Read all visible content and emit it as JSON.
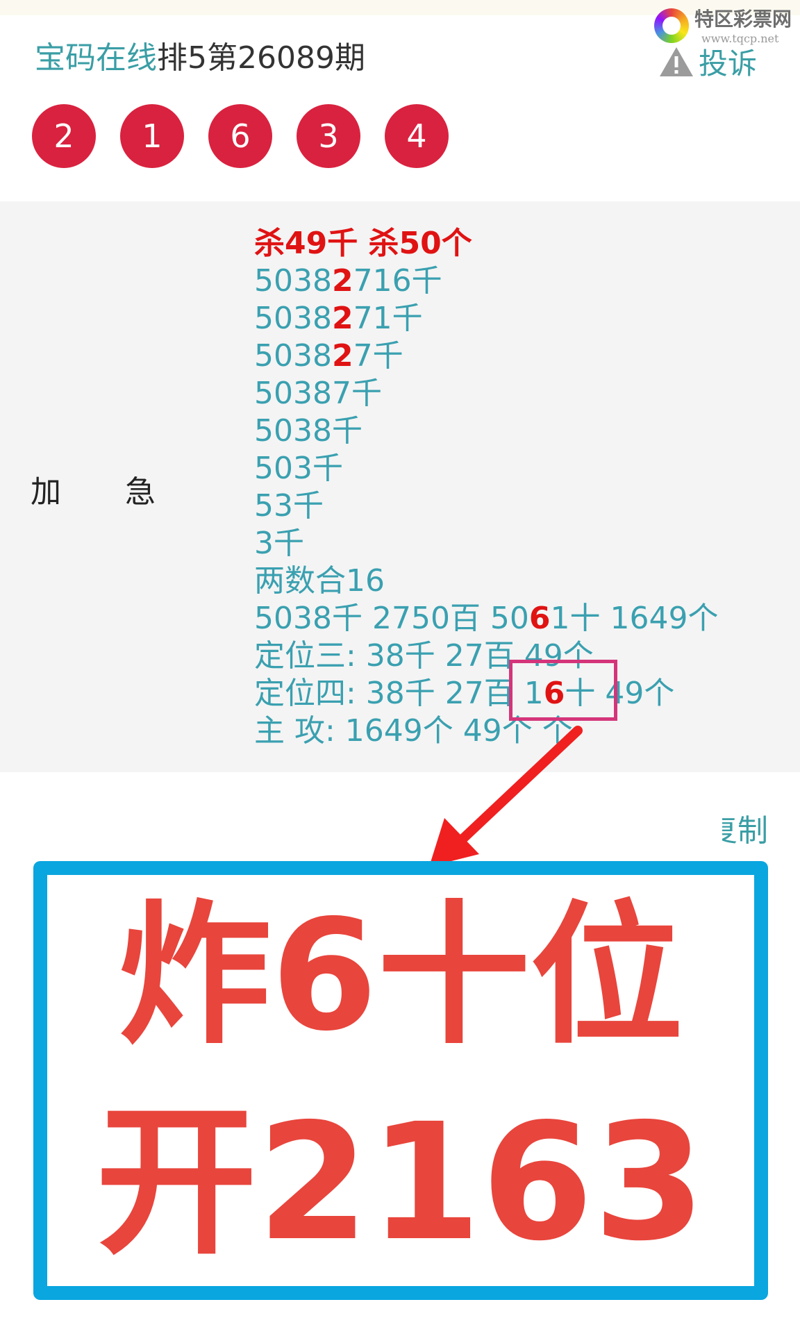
{
  "header": {
    "site_name": "宝码在线",
    "issue_title": "排5第26089期",
    "complaint_label": "投诉"
  },
  "watermark": {
    "name": "特区彩票网",
    "url": "www.tqcp.net"
  },
  "draw_numbers": [
    "2",
    "1",
    "6",
    "3",
    "4"
  ],
  "section_label": [
    "加",
    "急"
  ],
  "prediction_lines": [
    {
      "type": "kill",
      "parts": [
        {
          "text": "杀49千 杀50个"
        }
      ]
    },
    {
      "parts": [
        {
          "text": "5038"
        },
        {
          "text": "2",
          "hl": true
        },
        {
          "text": "716千"
        }
      ]
    },
    {
      "parts": [
        {
          "text": "5038"
        },
        {
          "text": "2",
          "hl": true
        },
        {
          "text": "71千"
        }
      ]
    },
    {
      "parts": [
        {
          "text": "5038"
        },
        {
          "text": "2",
          "hl": true
        },
        {
          "text": "7千"
        }
      ]
    },
    {
      "parts": [
        {
          "text": "50387千"
        }
      ]
    },
    {
      "parts": [
        {
          "text": "5038千"
        }
      ]
    },
    {
      "parts": [
        {
          "text": "503千"
        }
      ]
    },
    {
      "parts": [
        {
          "text": "53千"
        }
      ]
    },
    {
      "parts": [
        {
          "text": "3千"
        }
      ]
    },
    {
      "parts": [
        {
          "text": "两数合16"
        }
      ]
    },
    {
      "parts": [
        {
          "text": "5038千 2750百 50"
        },
        {
          "text": "6",
          "hl": true
        },
        {
          "text": "1十 1649个"
        }
      ]
    },
    {
      "parts": [
        {
          "text": "定位三: 38千 27百 49个"
        }
      ]
    },
    {
      "parts": [
        {
          "text": "定位四:  38千 27百 1"
        },
        {
          "text": "6",
          "hl": true
        },
        {
          "text": "十 49个"
        }
      ]
    },
    {
      "parts": [
        {
          "text": "主 攻:  1649个 49个 个"
        }
      ]
    }
  ],
  "copy_fragment": "复制",
  "banner": {
    "line1": "炸6十位",
    "line2": "开2163"
  },
  "colors": {
    "ball": "#d9223f",
    "teal_text": "#3aa0b0",
    "highlight_red": "#e01313",
    "highlight_box": "#d4357a",
    "banner_border": "#0aa6df",
    "banner_text": "#e8453c",
    "arrow": "#f02020"
  },
  "icons": [
    "warning-triangle-icon",
    "lottery-logo-icon"
  ]
}
